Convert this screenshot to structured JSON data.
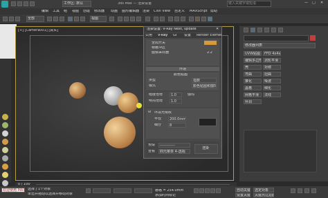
{
  "title_bar": {
    "title": "3ds Max — 渲染设置",
    "search_placeholder": "键入关键字或短语"
  },
  "menu": {
    "items": [
      "编辑",
      "工具",
      "组",
      "视图",
      "创建",
      "修改器",
      "动画",
      "图形编辑器",
      "渲染",
      "Civil View",
      "自定义",
      "MAXScript",
      "帮助"
    ]
  },
  "toolbar": {
    "workspace_label": "工作区: 默认",
    "selection_filter": "全部",
    "view_dropdown": "视图"
  },
  "viewport": {
    "label": "[+] [Camera001] [真实]"
  },
  "dialog": {
    "title": "渲染设置: V-Ray Next, update",
    "tabs": [
      "公用",
      "V-Ray",
      "GI",
      "设置",
      "Render Elements"
    ],
    "row1": [
      "全局开关",
      "帧缓冲区",
      "图像采样器"
    ],
    "section_header": "环境",
    "group_label": "颜色贴图",
    "type_label": "类型",
    "type_value": "指数",
    "mode_label": "模式",
    "mode_value": "颜色贴图和伽玛",
    "multiplier_label": "暗度倍增",
    "bright_label": "明亮倍增",
    "gamma_label": "伽玛",
    "v1": "1.0",
    "v2": "1.0",
    "v3": "2.2",
    "ao_label": "环境光吸收",
    "radius_label": "半径",
    "radius_value": "200.0mm",
    "subdiv_label": "细分",
    "subdiv_value": "8",
    "camera_label": "摄影机",
    "camera_value": "透视",
    "preset_label": "预设",
    "view_label": "查看",
    "preset_value": "------------",
    "view_value": "四元菜单 4-透视",
    "render_button": "渲染"
  },
  "command_panel": {
    "dropdown": "修改器列表",
    "modifiers": [
      "UVW贴图",
      "FFD 4x4x4",
      "编辑多边形",
      "涡轮平滑",
      "壳",
      "对称",
      "弯曲",
      "扭曲",
      "锥化",
      "噪波",
      "晶格",
      "细化",
      "网格平滑",
      "法线",
      "补洞"
    ]
  },
  "status": {
    "selected": "选择了1个对象",
    "hint": "单击并拖动以选择并移动对象",
    "time": "0 / 100",
    "script_label": "欢迎使用 MAXScript",
    "grid": "栅格 = 254.0mm",
    "add_time_tag": "添加时间标记",
    "auto_key": "自动关键点",
    "selected_filter": "选定对象",
    "set_key": "设置关键点",
    "key_filters": "关键点过滤器..."
  }
}
